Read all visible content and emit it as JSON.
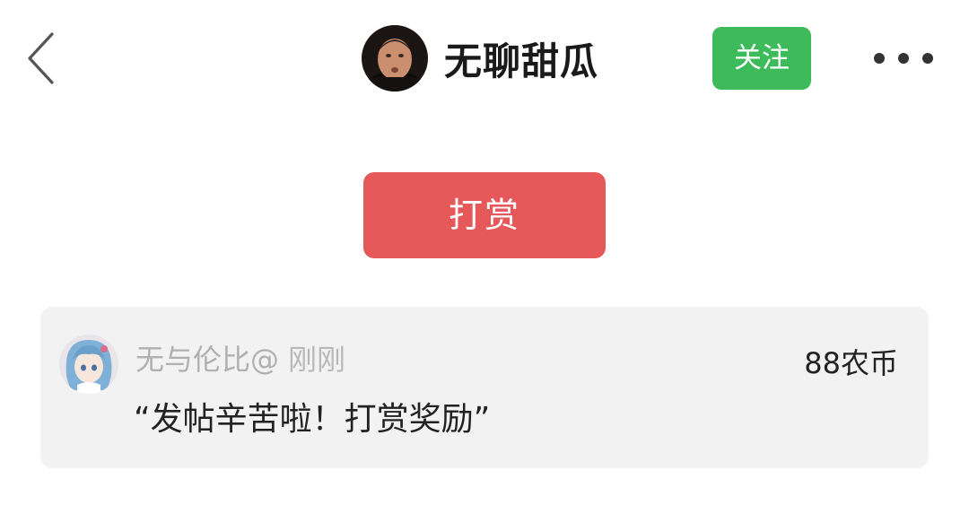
{
  "header": {
    "author_name": "无聊甜瓜",
    "follow_label": "关注"
  },
  "reward_button": {
    "label": "打赏"
  },
  "reward_record": {
    "tipper_name": "无与伦比@",
    "time": "刚刚",
    "amount": "88农币",
    "message": "“发帖辛苦啦！打赏奖励”"
  },
  "colors": {
    "follow_green": "#3dbb5b",
    "reward_red": "#e5595b",
    "card_background": "#f2f2f2"
  },
  "icons": [
    "back-chevron-icon",
    "more-dots-icon"
  ]
}
